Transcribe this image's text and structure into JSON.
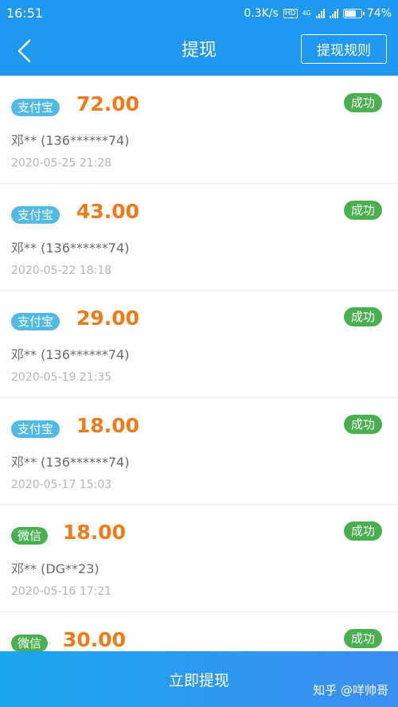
{
  "status_bar": {
    "time": "16:51",
    "net_speed": "0.3K/s",
    "hd": "HD",
    "net_type": "4G",
    "battery": "74%",
    "battery_level": 0.74
  },
  "header": {
    "title": "提现",
    "rules_label": "提现规则"
  },
  "records": [
    {
      "channel": "支付宝",
      "channel_type": "alipay",
      "amount": "72.00",
      "status": "成功",
      "account": "邓** (136******74)",
      "time": "2020-05-25 21:28"
    },
    {
      "channel": "支付宝",
      "channel_type": "alipay",
      "amount": "43.00",
      "status": "成功",
      "account": "邓** (136******74)",
      "time": "2020-05-22 18:18"
    },
    {
      "channel": "支付宝",
      "channel_type": "alipay",
      "amount": "29.00",
      "status": "成功",
      "account": "邓** (136******74)",
      "time": "2020-05-19 21:35"
    },
    {
      "channel": "支付宝",
      "channel_type": "alipay",
      "amount": "18.00",
      "status": "成功",
      "account": "邓** (136******74)",
      "time": "2020-05-17 15:03"
    },
    {
      "channel": "微信",
      "channel_type": "wechat",
      "amount": "18.00",
      "status": "成功",
      "account": "邓** (DG**23)",
      "time": "2020-05-16 17:21"
    },
    {
      "channel": "微信",
      "channel_type": "wechat",
      "amount": "30.00",
      "status": "成功",
      "account": "",
      "time": ""
    }
  ],
  "footer": {
    "withdraw_label": "立即提现",
    "watermark": "知乎 @咩帅哥"
  },
  "colors": {
    "primary": "#1e98f0",
    "amount": "#f07a16",
    "alipay": "#50b9e6",
    "success": "#48b04e"
  }
}
